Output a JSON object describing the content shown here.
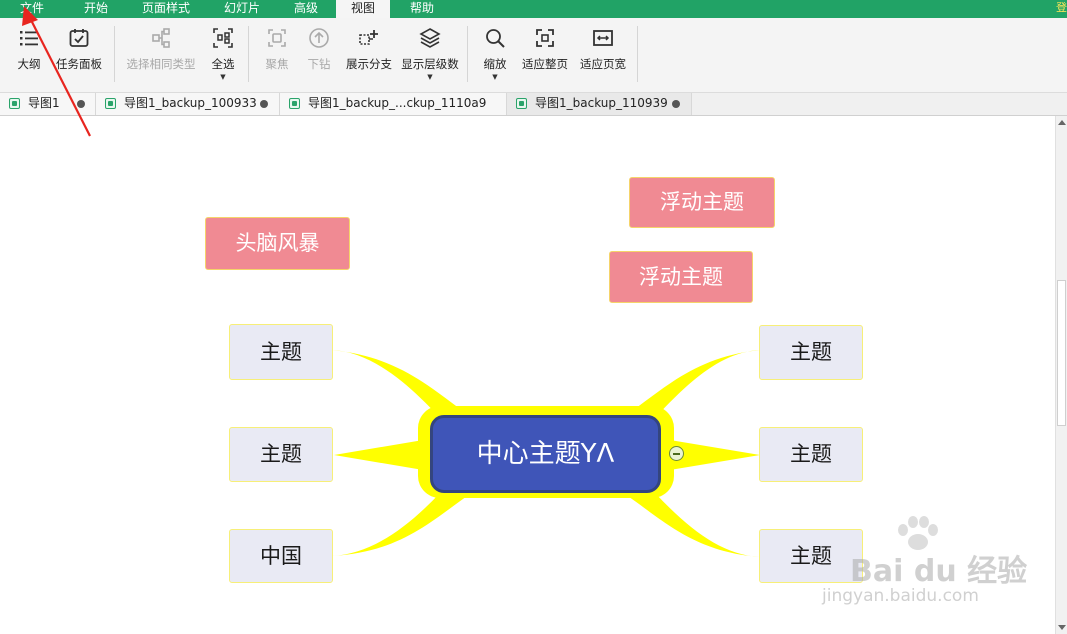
{
  "menubar": {
    "items": [
      "文件",
      "开始",
      "页面样式",
      "幻灯片",
      "高级",
      "视图",
      "帮助"
    ],
    "active": "视图",
    "edge_text": "登"
  },
  "toolbar": {
    "outline": "大纲",
    "task_panel": "任务面板",
    "select_same_type": "选择相同类型",
    "select_all": "全选",
    "focus": "聚焦",
    "drill_down": "下钻",
    "expand_branch": "展示分支",
    "show_levels": "显示层级数",
    "zoom": "缩放",
    "fit_page": "适应整页",
    "fit_width": "适应页宽"
  },
  "tabs": [
    {
      "label": "导图1"
    },
    {
      "label": "导图1_backup_100933"
    },
    {
      "label": "导图1_backup_...ckup_1110a9"
    },
    {
      "label": "导图1_backup_110939"
    }
  ],
  "mindmap": {
    "central": "中心主题YΛ",
    "brainstorm": "头脑风暴",
    "floating1": "浮动主题",
    "floating2": "浮动主题",
    "left_topics": [
      "主题",
      "主题",
      "中国"
    ],
    "right_topics": [
      "主题",
      "主题",
      "主题"
    ]
  },
  "watermark": {
    "text": "Bai du 经验",
    "url": "jingyan.baidu.com"
  },
  "colors": {
    "menubar": "#21a366",
    "branch": "#ffff00",
    "central_fill": "#3f55b8",
    "float_fill": "#f08a93",
    "topic_fill": "#e9eaf4",
    "annotation_arrow": "#e8251f"
  }
}
